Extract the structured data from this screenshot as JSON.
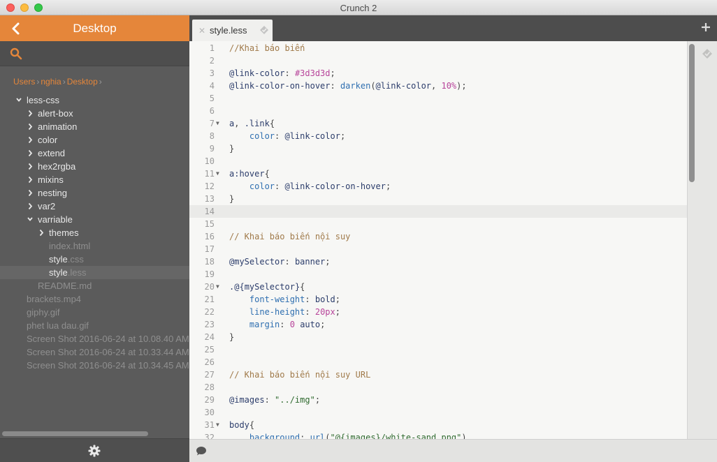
{
  "window": {
    "title": "Crunch 2"
  },
  "sidebar": {
    "title": "Desktop",
    "breadcrumb": [
      "Users",
      "nghia",
      "Desktop"
    ],
    "tree": [
      {
        "indent": 0,
        "chevron": "down",
        "name": "less-css",
        "ext": "",
        "dim": false,
        "selected": false
      },
      {
        "indent": 1,
        "chevron": "right",
        "name": "alert-box",
        "ext": "",
        "dim": false,
        "selected": false
      },
      {
        "indent": 1,
        "chevron": "right",
        "name": "animation",
        "ext": "",
        "dim": false,
        "selected": false
      },
      {
        "indent": 1,
        "chevron": "right",
        "name": "color",
        "ext": "",
        "dim": false,
        "selected": false
      },
      {
        "indent": 1,
        "chevron": "right",
        "name": "extend",
        "ext": "",
        "dim": false,
        "selected": false
      },
      {
        "indent": 1,
        "chevron": "right",
        "name": "hex2rgba",
        "ext": "",
        "dim": false,
        "selected": false
      },
      {
        "indent": 1,
        "chevron": "right",
        "name": "mixins",
        "ext": "",
        "dim": false,
        "selected": false
      },
      {
        "indent": 1,
        "chevron": "right",
        "name": "nesting",
        "ext": "",
        "dim": false,
        "selected": false
      },
      {
        "indent": 1,
        "chevron": "right",
        "name": "var2",
        "ext": "",
        "dim": false,
        "selected": false
      },
      {
        "indent": 1,
        "chevron": "down",
        "name": "varriable",
        "ext": "",
        "dim": false,
        "selected": false
      },
      {
        "indent": 2,
        "chevron": "right",
        "name": "themes",
        "ext": "",
        "dim": false,
        "selected": false
      },
      {
        "indent": 2,
        "chevron": "",
        "name": "index",
        "ext": ".html",
        "dim": true,
        "selected": false
      },
      {
        "indent": 2,
        "chevron": "",
        "name": "style",
        "ext": ".css",
        "dim": false,
        "selected": false
      },
      {
        "indent": 2,
        "chevron": "",
        "name": "style",
        "ext": ".less",
        "dim": false,
        "selected": true
      },
      {
        "indent": 1,
        "chevron": "",
        "name": "README",
        "ext": ".md",
        "dim": true,
        "selected": false
      },
      {
        "indent": 0,
        "chevron": "",
        "name": "brackets",
        "ext": ".mp4",
        "dim": true,
        "selected": false
      },
      {
        "indent": 0,
        "chevron": "",
        "name": "giphy",
        "ext": ".gif",
        "dim": true,
        "selected": false
      },
      {
        "indent": 0,
        "chevron": "",
        "name": "phet lua dau",
        "ext": ".gif",
        "dim": true,
        "selected": false
      },
      {
        "indent": 0,
        "chevron": "",
        "name": "Screen Shot 2016-06-24 at 10.08.40 AM",
        "ext": "",
        "dim": true,
        "selected": false
      },
      {
        "indent": 0,
        "chevron": "",
        "name": "Screen Shot 2016-06-24 at 10.33.44 AM",
        "ext": "",
        "dim": true,
        "selected": false
      },
      {
        "indent": 0,
        "chevron": "",
        "name": "Screen Shot 2016-06-24 at 10.34.45 AM",
        "ext": "",
        "dim": true,
        "selected": false
      }
    ]
  },
  "tabs": [
    {
      "label": "style.less",
      "active": true
    }
  ],
  "editor": {
    "active_line": 14,
    "lines": [
      {
        "n": 1,
        "fold": false,
        "tokens": [
          [
            "c-comment",
            "//Khai báo biến"
          ]
        ]
      },
      {
        "n": 2,
        "fold": false,
        "tokens": []
      },
      {
        "n": 3,
        "fold": false,
        "tokens": [
          [
            "c-var",
            "@link-color"
          ],
          [
            "c-punct",
            ": "
          ],
          [
            "c-hex",
            "#3d3d3d"
          ],
          [
            "c-punct",
            ";"
          ]
        ]
      },
      {
        "n": 4,
        "fold": false,
        "tokens": [
          [
            "c-var",
            "@link-color-on-hover"
          ],
          [
            "c-punct",
            ": "
          ],
          [
            "c-func",
            "darken"
          ],
          [
            "c-punct",
            "("
          ],
          [
            "c-var",
            "@link-color"
          ],
          [
            "c-punct",
            ", "
          ],
          [
            "c-num",
            "10%"
          ],
          [
            "c-punct",
            ");"
          ]
        ]
      },
      {
        "n": 5,
        "fold": false,
        "tokens": []
      },
      {
        "n": 6,
        "fold": false,
        "tokens": []
      },
      {
        "n": 7,
        "fold": true,
        "tokens": [
          [
            "c-sel",
            "a"
          ],
          [
            "c-punct",
            ", "
          ],
          [
            "c-sel",
            ".link"
          ],
          [
            "c-punct",
            "{"
          ]
        ]
      },
      {
        "n": 8,
        "fold": false,
        "tokens": [
          [
            "c-punct",
            "    "
          ],
          [
            "c-prop",
            "color"
          ],
          [
            "c-punct",
            ": "
          ],
          [
            "c-var",
            "@link-color"
          ],
          [
            "c-punct",
            ";"
          ]
        ]
      },
      {
        "n": 9,
        "fold": false,
        "tokens": [
          [
            "c-punct",
            "}"
          ]
        ]
      },
      {
        "n": 10,
        "fold": false,
        "tokens": []
      },
      {
        "n": 11,
        "fold": true,
        "tokens": [
          [
            "c-sel",
            "a:hover"
          ],
          [
            "c-punct",
            "{"
          ]
        ]
      },
      {
        "n": 12,
        "fold": false,
        "tokens": [
          [
            "c-punct",
            "    "
          ],
          [
            "c-prop",
            "color"
          ],
          [
            "c-punct",
            ": "
          ],
          [
            "c-var",
            "@link-color-on-hover"
          ],
          [
            "c-punct",
            ";"
          ]
        ]
      },
      {
        "n": 13,
        "fold": false,
        "tokens": [
          [
            "c-punct",
            "}"
          ]
        ]
      },
      {
        "n": 14,
        "fold": false,
        "tokens": []
      },
      {
        "n": 15,
        "fold": false,
        "tokens": []
      },
      {
        "n": 16,
        "fold": false,
        "tokens": [
          [
            "c-comment",
            "// Khai báo biến nội suy"
          ]
        ]
      },
      {
        "n": 17,
        "fold": false,
        "tokens": []
      },
      {
        "n": 18,
        "fold": false,
        "tokens": [
          [
            "c-var",
            "@mySelector"
          ],
          [
            "c-punct",
            ": "
          ],
          [
            "c-kw",
            "banner"
          ],
          [
            "c-punct",
            ";"
          ]
        ]
      },
      {
        "n": 19,
        "fold": false,
        "tokens": []
      },
      {
        "n": 20,
        "fold": true,
        "tokens": [
          [
            "c-sel",
            ".@{"
          ],
          [
            "c-var",
            "mySelector"
          ],
          [
            "c-sel",
            "}"
          ],
          [
            "c-punct",
            "{"
          ]
        ]
      },
      {
        "n": 21,
        "fold": false,
        "tokens": [
          [
            "c-punct",
            "    "
          ],
          [
            "c-prop",
            "font-weight"
          ],
          [
            "c-punct",
            ": "
          ],
          [
            "c-kw",
            "bold"
          ],
          [
            "c-punct",
            ";"
          ]
        ]
      },
      {
        "n": 22,
        "fold": false,
        "tokens": [
          [
            "c-punct",
            "    "
          ],
          [
            "c-prop",
            "line-height"
          ],
          [
            "c-punct",
            ": "
          ],
          [
            "c-num",
            "20px"
          ],
          [
            "c-punct",
            ";"
          ]
        ]
      },
      {
        "n": 23,
        "fold": false,
        "tokens": [
          [
            "c-punct",
            "    "
          ],
          [
            "c-prop",
            "margin"
          ],
          [
            "c-punct",
            ": "
          ],
          [
            "c-num",
            "0"
          ],
          [
            "c-punct",
            " "
          ],
          [
            "c-kw",
            "auto"
          ],
          [
            "c-punct",
            ";"
          ]
        ]
      },
      {
        "n": 24,
        "fold": false,
        "tokens": [
          [
            "c-punct",
            "}"
          ]
        ]
      },
      {
        "n": 25,
        "fold": false,
        "tokens": []
      },
      {
        "n": 26,
        "fold": false,
        "tokens": []
      },
      {
        "n": 27,
        "fold": false,
        "tokens": [
          [
            "c-comment",
            "// Khai báo biến nội suy URL"
          ]
        ]
      },
      {
        "n": 28,
        "fold": false,
        "tokens": []
      },
      {
        "n": 29,
        "fold": false,
        "tokens": [
          [
            "c-var",
            "@images"
          ],
          [
            "c-punct",
            ": "
          ],
          [
            "c-str",
            "\"../img\""
          ],
          [
            "c-punct",
            ";"
          ]
        ]
      },
      {
        "n": 30,
        "fold": false,
        "tokens": []
      },
      {
        "n": 31,
        "fold": true,
        "tokens": [
          [
            "c-sel",
            "body"
          ],
          [
            "c-punct",
            "{"
          ]
        ]
      },
      {
        "n": 32,
        "fold": false,
        "tokens": [
          [
            "c-punct",
            "    "
          ],
          [
            "c-prop",
            "background"
          ],
          [
            "c-punct",
            ": "
          ],
          [
            "c-func",
            "url"
          ],
          [
            "c-punct",
            "("
          ],
          [
            "c-str",
            "\"@{images}/white-sand.png\""
          ],
          [
            "c-punct",
            ")"
          ]
        ]
      }
    ]
  },
  "colors": {
    "accent": "#e5863a",
    "sidebar_bg": "#5b5b5b",
    "editor_bg": "#f7f7f5"
  },
  "icons": {
    "back": "chevron-left-icon",
    "search": "search-icon",
    "settings": "gear-icon",
    "add_tab": "plus-icon",
    "chat": "speech-bubble-icon",
    "crunch": "crunch-diamond-icon"
  }
}
